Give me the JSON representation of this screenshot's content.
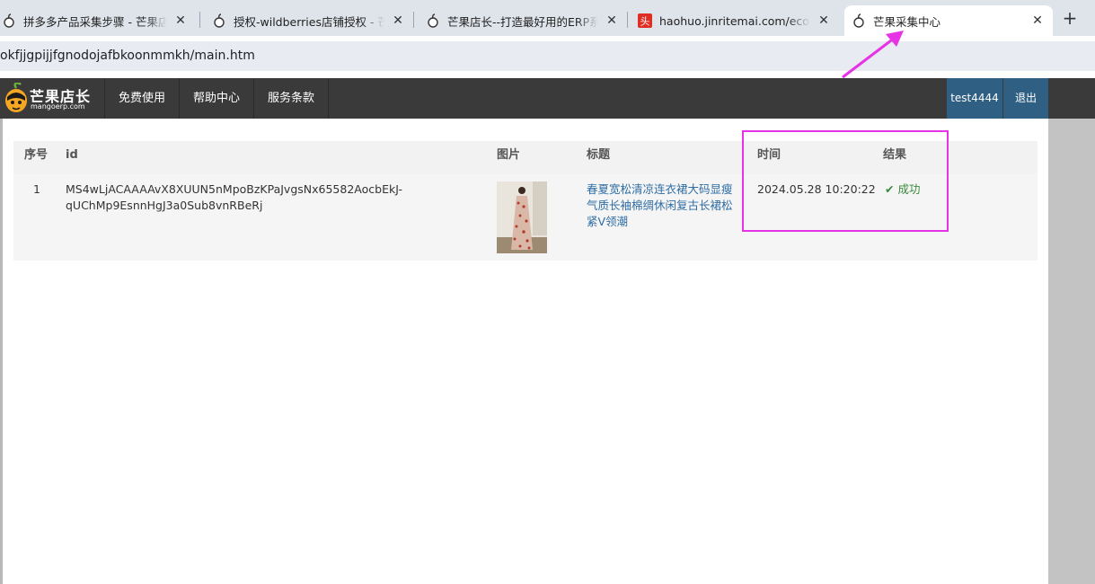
{
  "browser": {
    "tabs": [
      {
        "title": "拼多多产品采集步骤 - 芒果店长",
        "icon": "mango-favicon"
      },
      {
        "title": "授权-wildberries店铺授权 - 芒果",
        "icon": "mango-favicon"
      },
      {
        "title": "芒果店长--打造最好用的ERP系统",
        "icon": "mango-favicon"
      },
      {
        "title": "haohuo.jinritemai.com/ecom",
        "icon": "toutiao-favicon"
      },
      {
        "title": "芒果采集中心",
        "icon": "mango-favicon",
        "active": true
      }
    ],
    "new_tab": "+",
    "url": "okfjjgpijjfgnodojafbkoonmmkh/main.htm"
  },
  "site": {
    "logo_title": "芒果店长",
    "logo_sub": "mangoerp.com",
    "nav": [
      "免费使用",
      "帮助中心",
      "服务条款"
    ],
    "user": "test4444",
    "logout": "退出"
  },
  "table": {
    "headers": {
      "index": "序号",
      "id": "id",
      "image": "图片",
      "title": "标题",
      "time": "时间",
      "result": "结果"
    },
    "rows": [
      {
        "index": "1",
        "id_line1": "MS4wLjACAAAAvX8XUUN5nMpoBzKPaJvgsNx65582AocbEkJ-",
        "id_line2": "qUChMp9EsnnHgJ3a0Sub8vnRBeRj",
        "title_line1": "春夏宽松清凉连衣裙大码显瘦",
        "title_line2": "气质长袖棉绸休闲复古长裙松",
        "title_line3": "紧V领潮",
        "time": "2024.05.28 10:20:22",
        "result": "成功"
      }
    ]
  },
  "colors": {
    "highlight": "#e633e6",
    "nav_bg": "#3a3a3a",
    "user_bg": "#2f5f83",
    "link": "#2f6da3",
    "success": "#3a8a3a"
  }
}
